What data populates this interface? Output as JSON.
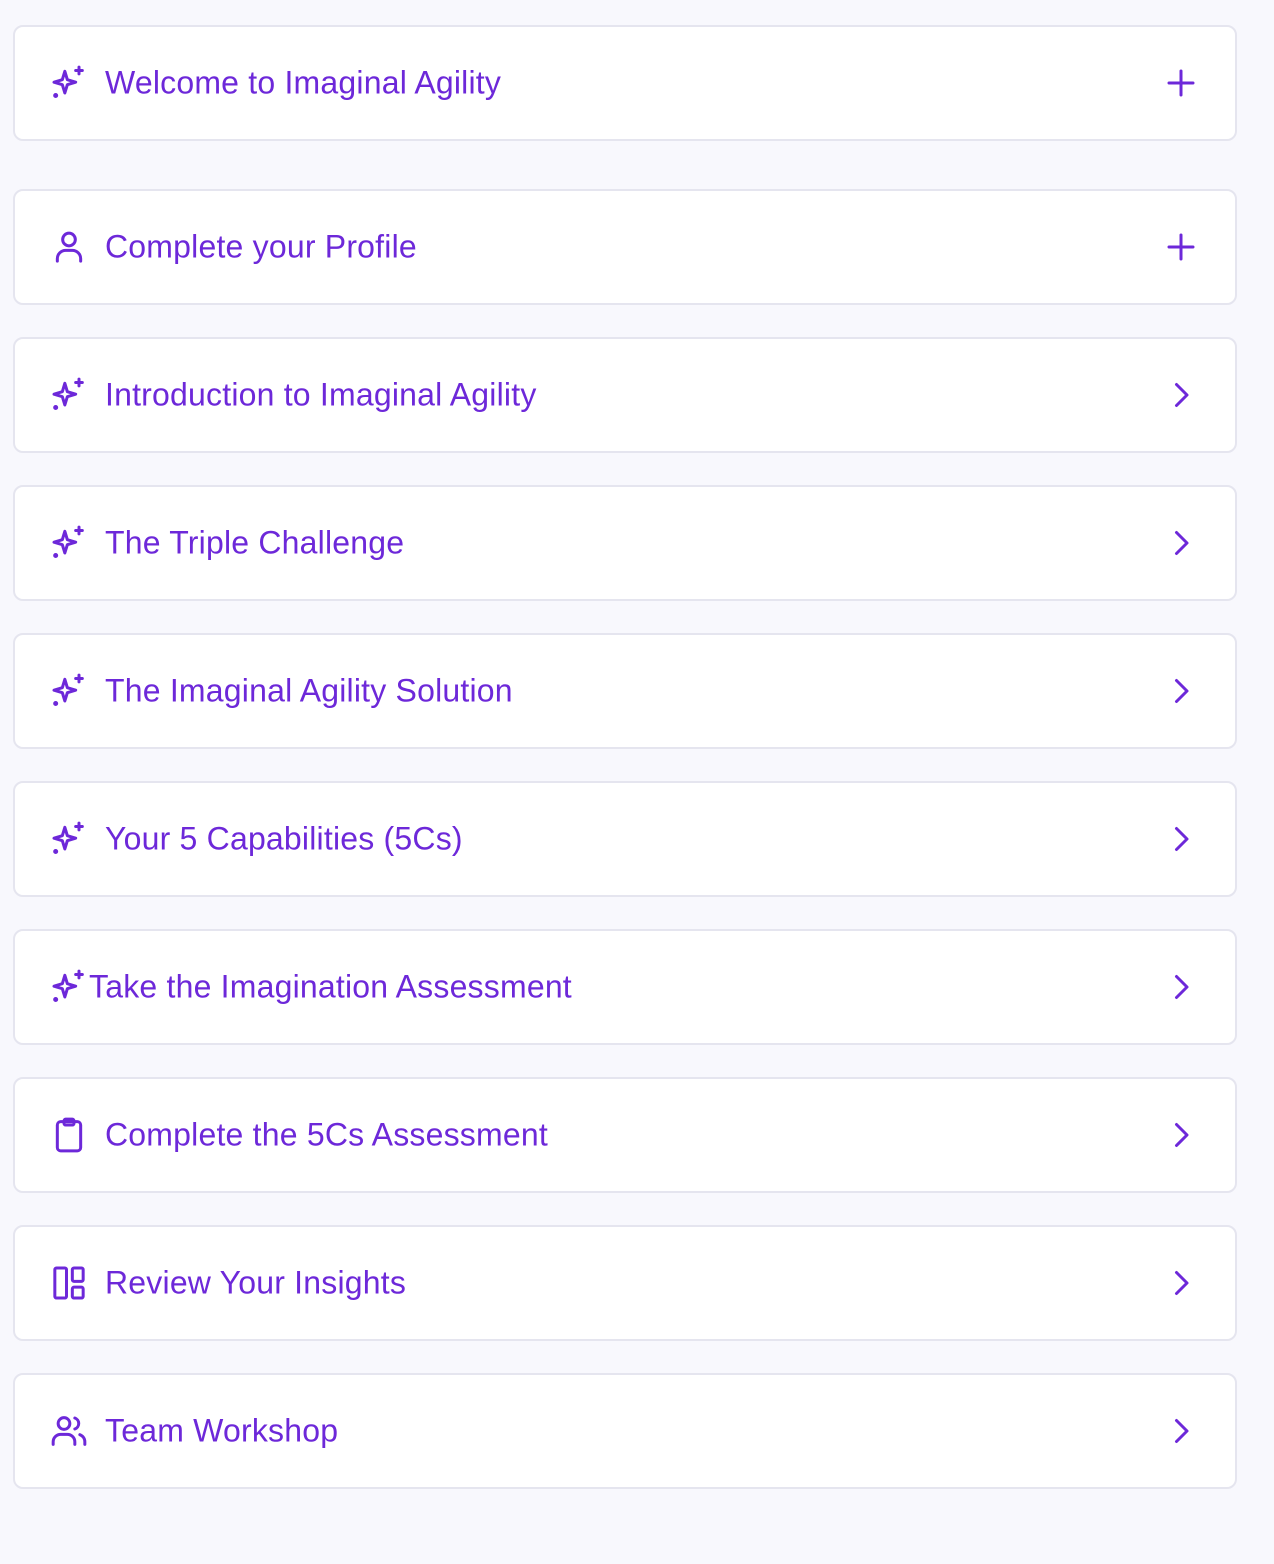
{
  "theme": {
    "accent": "#6d28d9",
    "card_border": "#e5e5ef",
    "background": "#f8f8fd"
  },
  "steps": [
    {
      "label": "Welcome to Imaginal Agility",
      "icon": "sparkles-icon",
      "action": "plus-icon"
    },
    {
      "label": "Complete your Profile",
      "icon": "user-icon",
      "action": "plus-icon"
    },
    {
      "label": "Introduction to Imaginal Agility",
      "icon": "sparkles-icon",
      "action": "chevron-right-icon"
    },
    {
      "label": "The Triple Challenge",
      "icon": "sparkles-icon",
      "action": "chevron-right-icon"
    },
    {
      "label": "The Imaginal Agility Solution",
      "icon": "sparkles-icon",
      "action": "chevron-right-icon"
    },
    {
      "label": "Your 5 Capabilities (5Cs)",
      "icon": "sparkles-icon",
      "action": "chevron-right-icon"
    },
    {
      "label": "Take the Imagination Assessment",
      "icon": "sparkles-icon",
      "action": "chevron-right-icon"
    },
    {
      "label": "Complete the 5Cs Assessment",
      "icon": "clipboard-icon",
      "action": "chevron-right-icon"
    },
    {
      "label": "Review Your Insights",
      "icon": "layout-dashboard-icon",
      "action": "chevron-right-icon"
    },
    {
      "label": "Team Workshop",
      "icon": "users-icon",
      "action": "chevron-right-icon"
    }
  ]
}
